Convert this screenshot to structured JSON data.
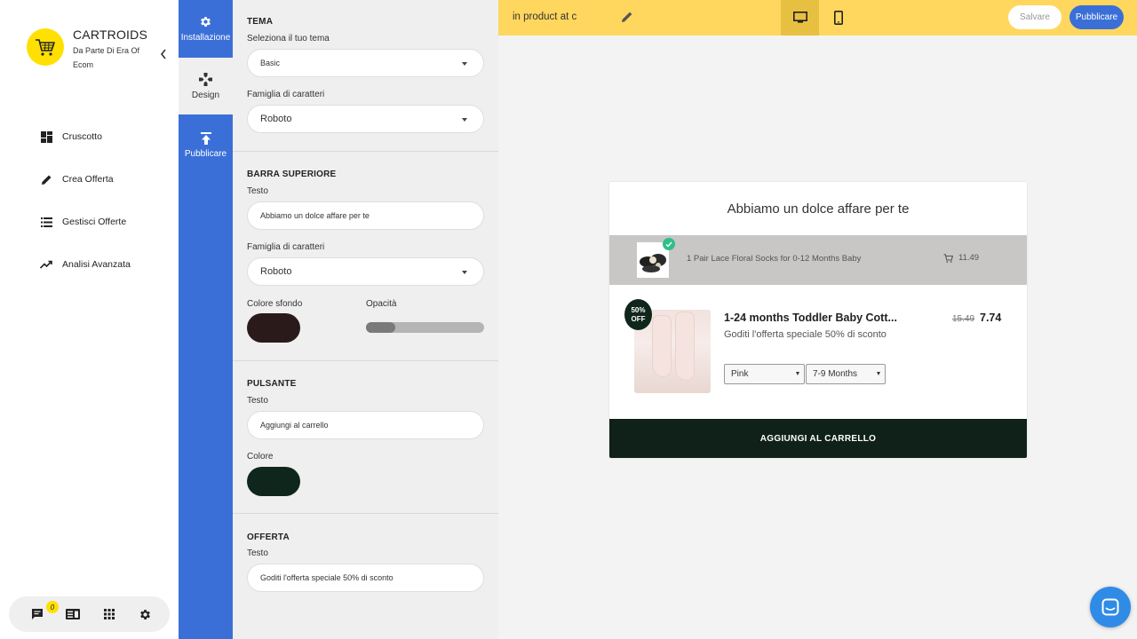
{
  "brand": {
    "title": "CARTROIDS",
    "subtitle": "Da Parte Di Era Of Ecom"
  },
  "nav": [
    {
      "label": "Cruscotto",
      "icon": "dashboard-icon"
    },
    {
      "label": "Crea Offerta",
      "icon": "pencil-icon"
    },
    {
      "label": "Gestisci Offerte",
      "icon": "list-icon"
    },
    {
      "label": "Analisi Avanzata",
      "icon": "trending-up-icon"
    }
  ],
  "bottom_bar": {
    "chat_count": "0",
    "icons": [
      "chat-icon",
      "news-icon",
      "apps-grid-icon",
      "gear-icon"
    ]
  },
  "rail": [
    {
      "label": "Installazione",
      "icon": "gear-icon"
    },
    {
      "label": "Design",
      "icon": "gamepad-icon"
    },
    {
      "label": "Pubblicare",
      "icon": "upload-icon"
    }
  ],
  "panel": {
    "tema": {
      "title": "TEMA",
      "theme_label": "Seleziona il tuo tema",
      "theme_value": "Basic",
      "font_label": "Famiglia di caratteri",
      "font_value": "Roboto"
    },
    "barra": {
      "title": "BARRA SUPERIORE",
      "text_label": "Testo",
      "text_value": "Abbiamo un dolce affare per te",
      "font_label": "Famiglia di caratteri",
      "font_value": "Roboto",
      "bg_label": "Colore sfondo",
      "bg_color": "#2a1a1a",
      "opacity_label": "Opacità",
      "opacity_value": 0.25
    },
    "pulsante": {
      "title": "PULSANTE",
      "text_label": "Testo",
      "text_value": "Aggiungi al carrello",
      "color_label": "Colore",
      "color": "#0f261c"
    },
    "offerta": {
      "title": "OFFERTA",
      "text_label": "Testo",
      "text_value": "Goditi l'offerta speciale 50% di sconto"
    }
  },
  "topbar": {
    "title": "in product at c",
    "save": "Salvare",
    "publish": "Pubblicare",
    "active_device": "desktop"
  },
  "preview": {
    "header": "Abbiamo un dolce affare per te",
    "cart_item": {
      "name": "1 Pair Lace Floral Socks for 0-12 Months Baby",
      "price": "11.49"
    },
    "offer": {
      "badge_top": "50%",
      "badge_bottom": "OFF",
      "title": "1-24 months Toddler Baby Cott...",
      "subtitle": "Goditi l'offerta speciale 50% di sconto",
      "old_price": "15.49",
      "new_price": "7.74",
      "color_option": "Pink",
      "size_option": "7-9 Months"
    },
    "button": "AGGIUNGI AL CARRELLO"
  },
  "colors": {
    "accent_blue": "#3b6fd8",
    "topbar_yellow": "#ffd75e",
    "brand_yellow": "#ffe000",
    "dark_green": "#0f2119"
  }
}
